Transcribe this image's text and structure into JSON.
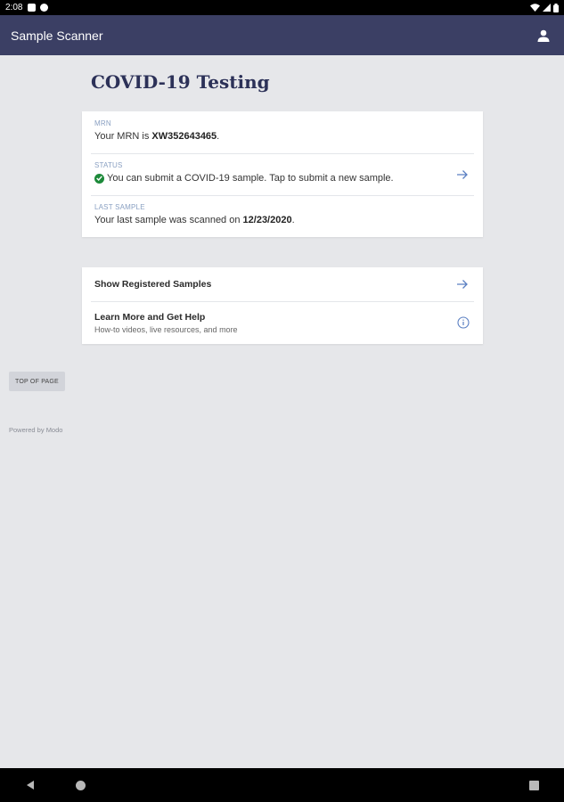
{
  "status_bar": {
    "time": "2:08"
  },
  "app_bar": {
    "title": "Sample Scanner",
    "account_icon": "account-icon"
  },
  "page": {
    "heading": "COVID-19 Testing"
  },
  "info_card": {
    "mrn": {
      "label": "MRN",
      "prefix": "Your MRN is ",
      "value": "XW352643465",
      "suffix": "."
    },
    "status": {
      "label": "STATUS",
      "text": "You can submit a COVID-19 sample. Tap to submit a new sample."
    },
    "last_sample": {
      "label": "LAST SAMPLE",
      "prefix": "Your last sample was scanned on ",
      "value": "12/23/2020",
      "suffix": "."
    }
  },
  "links_card": {
    "show_samples": {
      "title": "Show Registered Samples"
    },
    "learn_more": {
      "title": "Learn More and Get Help",
      "subtitle": "How-to videos, live resources, and more"
    }
  },
  "footer": {
    "top_of_page": "TOP OF PAGE",
    "powered_by": "Powered by Modo"
  },
  "colors": {
    "app_bar": "#3b3f64",
    "accent": "#5a7fc2",
    "success": "#1d8a3a",
    "background": "#e6e7ea"
  }
}
